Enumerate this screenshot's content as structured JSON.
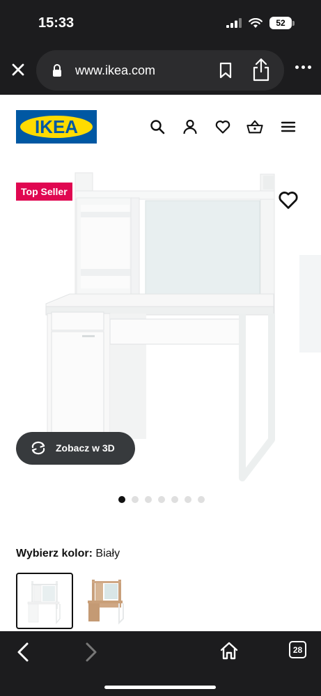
{
  "status_bar": {
    "time": "15:33",
    "battery": "52"
  },
  "browser": {
    "url": "www.ikea.com",
    "tab_count": "28"
  },
  "site": {
    "logo_text": "IKEA",
    "header_icons": [
      "search-icon",
      "user-icon",
      "heart-icon",
      "basket-icon",
      "menu-icon"
    ]
  },
  "product": {
    "badge": "Top Seller",
    "view_3d_label": "Zobacz w 3D",
    "gallery_dots": 7,
    "gallery_active_index": 0
  },
  "color_selector": {
    "label": "Wybierz kolor:",
    "selected_value": "Biały",
    "options": [
      "white",
      "oak"
    ]
  },
  "colors": {
    "ikea_blue": "#0058a3",
    "ikea_yellow": "#ffdb00",
    "badge_red": "#e00751",
    "browser_chrome": "#1c1c1e"
  }
}
